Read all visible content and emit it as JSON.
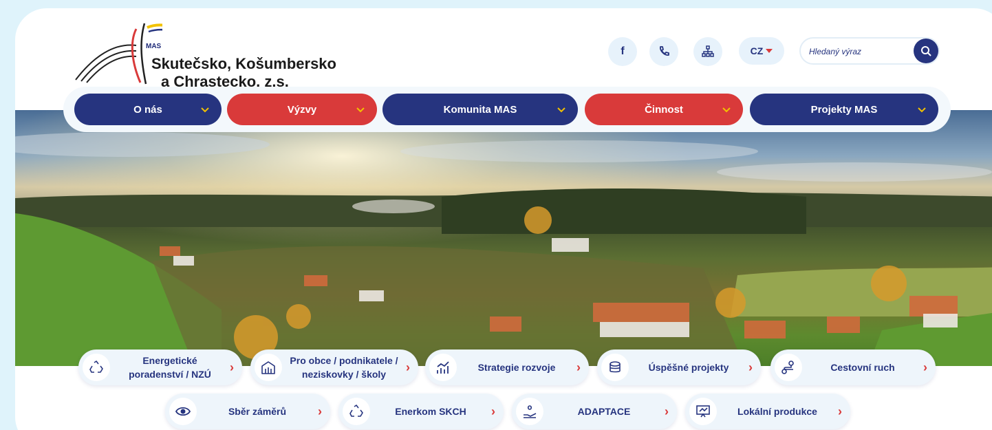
{
  "header": {
    "logo": {
      "small": "MAS",
      "line1": "Skutečsko, Košumbersko",
      "line2": "a Chrastecko, z.s."
    },
    "icons": [
      "facebook-icon",
      "phone-icon",
      "sitemap-icon"
    ],
    "facebook_glyph": "f",
    "language": "CZ",
    "search_placeholder": "Hledaný výraz"
  },
  "nav": {
    "items": [
      {
        "label": "O nás",
        "color": "#26347f"
      },
      {
        "label": "Výzvy",
        "color": "#d93a3a"
      },
      {
        "label": "Komunita MAS",
        "color": "#26347f"
      },
      {
        "label": "Činnost",
        "color": "#d93a3a"
      },
      {
        "label": "Projekty MAS",
        "color": "#26347f"
      }
    ]
  },
  "quick_links": {
    "row1": [
      {
        "line1": "Energetické",
        "line2": "poradenství / NZÚ",
        "icon": "recycle-icon"
      },
      {
        "line1": "Pro obce / podnikatele /",
        "line2": "neziskovky / školy",
        "icon": "building-icon"
      },
      {
        "line1": "Strategie rozvoje",
        "icon": "chart-icon"
      },
      {
        "line1": "Úspěšné projekty",
        "icon": "coins-icon"
      },
      {
        "line1": "Cestovní ruch",
        "icon": "route-icon"
      }
    ],
    "row2": [
      {
        "line1": "Sběr záměrů",
        "icon": "eye-icon"
      },
      {
        "line1": "Enerkom SKCH",
        "icon": "recycle-icon"
      },
      {
        "line1": "ADAPTACE",
        "icon": "hand-icon"
      },
      {
        "line1": "Lokální produkce",
        "icon": "presentation-icon"
      }
    ],
    "arrow": "›"
  },
  "colors": {
    "primary": "#26347f",
    "accent": "#d93a3a",
    "background": "#dff3fb"
  }
}
